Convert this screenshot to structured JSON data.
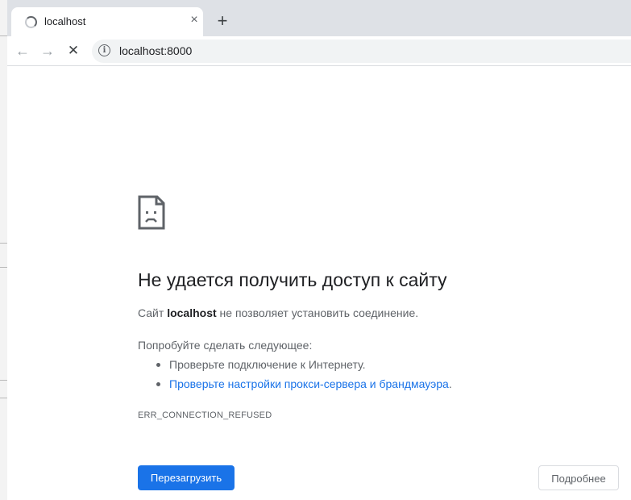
{
  "tab": {
    "title": "localhost",
    "close_label": "×",
    "new_tab_label": "+"
  },
  "toolbar": {
    "back_glyph": "←",
    "forward_glyph": "→",
    "stop_glyph": "✕",
    "url": "localhost:8000",
    "info_glyph": "i"
  },
  "error": {
    "icon": "sad-page-icon",
    "title": "Не удается получить доступ к сайту",
    "summary_prefix": "Сайт ",
    "summary_host": "localhost",
    "summary_suffix": " не позволяет установить соединение.",
    "suggestions_heading": "Попробуйте сделать следующее:",
    "suggestion_1": "Проверьте подключение к Интернету.",
    "suggestion_2_link": "Проверьте настройки прокси-сервера и брандмауэра",
    "suggestion_2_period": ".",
    "code": "ERR_CONNECTION_REFUSED"
  },
  "buttons": {
    "reload": "Перезагрузить",
    "details": "Подробнее"
  },
  "colors": {
    "accent": "#1a73e8",
    "tab_strip": "#dee1e6",
    "omnibox": "#f1f3f4",
    "text_secondary": "#5f6368"
  }
}
